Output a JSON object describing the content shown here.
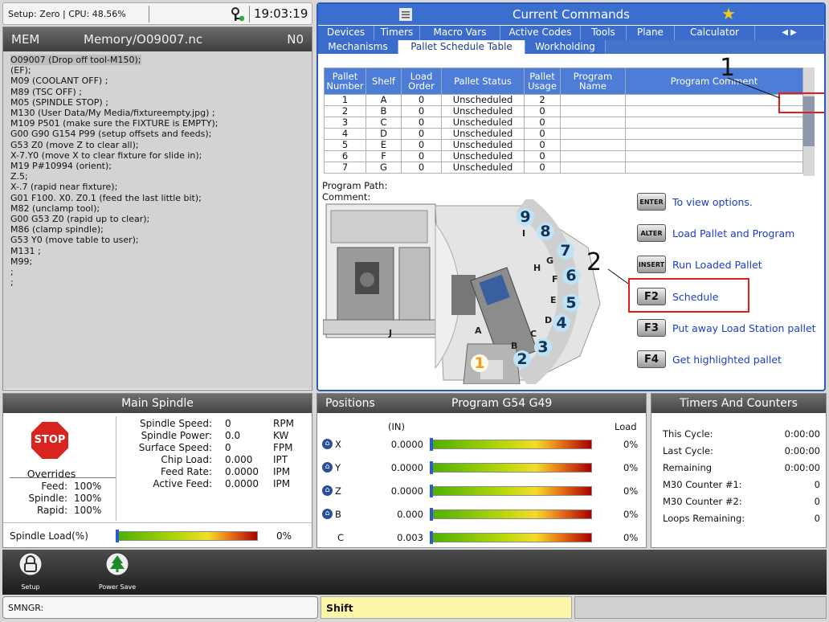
{
  "status": {
    "setup_text": "Setup: Zero | CPU: 48.56%",
    "clock": "19:03:19"
  },
  "program": {
    "mode": "MEM",
    "file": "Memory/O09007.nc",
    "block": "N0",
    "lines": [
      "O09007 (Drop off tool-M150);",
      "(EF);",
      "M09 (COOLANT OFF) ;",
      "M89 (TSC OFF) ;",
      "M05 (SPINDLE STOP) ;",
      "M130 (User Data/My Media/fixtureempty.jpg) ;",
      "M109 P501 (make sure the FIXTURE is EMPTY);",
      "G00 G90 G154 P99 (setup offsets and feeds);",
      "G53 Z0 (move Z to clear all);",
      "X-7.Y0 (move X to clear fixture for slide in);",
      "M19 P#10994 (orient);",
      "Z.5;",
      "X-.7 (rapid near fixture);",
      "G01 F100. X0. Z0.1 (feed the last little bit);",
      "M82 (unclamp tool);",
      "G00 G53 Z0 (rapid up to clear);",
      "M86 (clamp spindle);",
      "G53 Y0 (move table to user);",
      "M131 ;",
      "M99;",
      ";",
      ";"
    ]
  },
  "commands": {
    "title": "Current Commands",
    "tabs": [
      "Devices",
      "Timers",
      "Macro Vars",
      "Active Codes",
      "Tools",
      "Plane",
      "Calculator"
    ],
    "subtabs": [
      "Mechanisms",
      "Pallet Schedule Table",
      "Workholding"
    ],
    "table_headers": [
      "Pallet Number",
      "Shelf",
      "Load Order",
      "Pallet Status",
      "Pallet Usage",
      "Program Name",
      "Program Comment"
    ],
    "rows": [
      [
        "1",
        "A",
        "0",
        "Unscheduled",
        "2",
        "",
        ""
      ],
      [
        "2",
        "B",
        "0",
        "Unscheduled",
        "0",
        "",
        ""
      ],
      [
        "3",
        "C",
        "0",
        "Unscheduled",
        "0",
        "",
        ""
      ],
      [
        "4",
        "D",
        "0",
        "Unscheduled",
        "0",
        "",
        ""
      ],
      [
        "5",
        "E",
        "0",
        "Unscheduled",
        "0",
        "",
        ""
      ],
      [
        "6",
        "F",
        "0",
        "Unscheduled",
        "0",
        "",
        ""
      ],
      [
        "7",
        "G",
        "0",
        "Unscheduled",
        "0",
        "",
        ""
      ]
    ],
    "program_path": "Program Path:",
    "comment": "Comment:",
    "callout_1": "1",
    "callout_2": "2",
    "station_letters": [
      "A",
      "B",
      "C",
      "D",
      "E",
      "F",
      "G",
      "H",
      "I",
      "J"
    ],
    "station_numbers": [
      "1",
      "2",
      "3",
      "4",
      "5",
      "6",
      "7",
      "8",
      "9"
    ],
    "keys": [
      {
        "key": "ENTER",
        "label": "To view options."
      },
      {
        "key": "ALTER",
        "label": "Load Pallet and Program"
      },
      {
        "key": "INSERT",
        "label": "Run Loaded Pallet"
      },
      {
        "key": "F2",
        "label": "Schedule"
      },
      {
        "key": "F3",
        "label": "Put away Load Station pallet"
      },
      {
        "key": "F4",
        "label": "Get highlighted pallet"
      }
    ]
  },
  "spindle": {
    "title": "Main Spindle",
    "stop": "STOP",
    "overrides": "Overrides",
    "ov": [
      [
        "Feed:",
        "100%"
      ],
      [
        "Spindle:",
        "100%"
      ],
      [
        "Rapid:",
        "100%"
      ]
    ],
    "rows": [
      [
        "Spindle Speed:",
        "0",
        "RPM"
      ],
      [
        "Spindle Power:",
        "0.0",
        "KW"
      ],
      [
        "Surface Speed:",
        "0",
        "FPM"
      ],
      [
        "Chip Load:",
        "0.000",
        "IPT"
      ],
      [
        "Feed Rate:",
        "0.0000",
        "IPM"
      ],
      [
        "Active Feed:",
        "0.0000",
        "IPM"
      ]
    ],
    "load_label": "Spindle Load(%)",
    "load_value": "0%",
    "load_fraction": 0
  },
  "positions": {
    "title": "Positions",
    "program": "Program G54 G49",
    "unit": "(IN)",
    "load": "Load",
    "axes": [
      {
        "axis": "X",
        "value": "0.0000",
        "load": "0%",
        "fraction": 0
      },
      {
        "axis": "Y",
        "value": "0.0000",
        "load": "0%",
        "fraction": 0
      },
      {
        "axis": "Z",
        "value": "0.0000",
        "load": "0%",
        "fraction": 0
      },
      {
        "axis": "B",
        "value": "0.000",
        "load": "0%",
        "fraction": 0
      },
      {
        "axis": "C",
        "value": "0.003",
        "load": "0%",
        "fraction": 0
      }
    ]
  },
  "timers": {
    "title": "Timers And Counters",
    "rows": [
      [
        "This Cycle:",
        "0:00:00"
      ],
      [
        "Last Cycle:",
        "0:00:00"
      ],
      [
        "Remaining",
        "0:00:00"
      ],
      [
        "M30 Counter #1:",
        "0"
      ],
      [
        "M30 Counter #2:",
        "0"
      ],
      [
        "Loops Remaining:",
        "0"
      ]
    ]
  },
  "bottom": {
    "setup": "Setup",
    "power_save": "Power Save"
  },
  "statusbar": {
    "left": "SMNGR:",
    "shift": "Shift"
  },
  "colors": {
    "accent": "#3a6fcf",
    "highlight": "#f0a020",
    "callout": "#e02020"
  }
}
